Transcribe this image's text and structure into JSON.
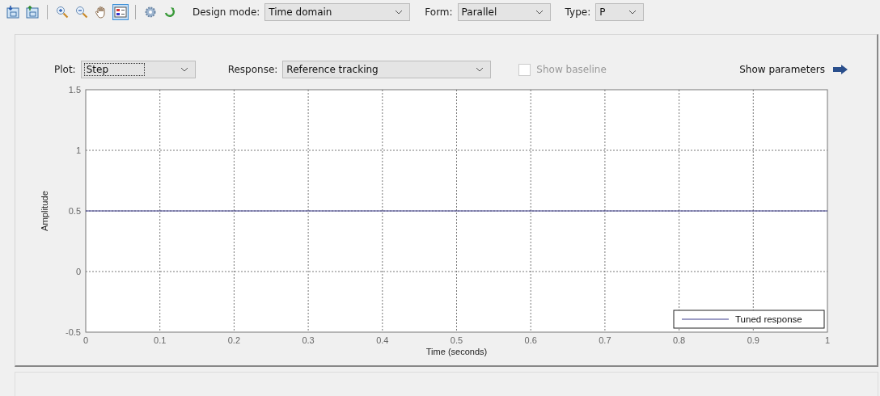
{
  "toolbar": {
    "tools": [
      {
        "kind": "import",
        "selected": false
      },
      {
        "kind": "export",
        "selected": false
      },
      {
        "kind": "separator"
      },
      {
        "kind": "zoom-in",
        "selected": false
      },
      {
        "kind": "zoom-out",
        "selected": false
      },
      {
        "kind": "pan",
        "selected": false
      },
      {
        "kind": "legend",
        "selected": true
      },
      {
        "kind": "separator"
      },
      {
        "kind": "settings",
        "selected": false
      },
      {
        "kind": "refresh",
        "selected": false
      }
    ],
    "fields": [
      {
        "label": "Design mode:",
        "value": "Time domain",
        "kind": "wide"
      },
      {
        "label": "Form:",
        "value": "Parallel",
        "kind": "medium"
      },
      {
        "label": "Type:",
        "value": "P",
        "kind": "narrow"
      }
    ]
  },
  "plot_controls": {
    "plot": {
      "label": "Plot:",
      "value": "Step"
    },
    "response": {
      "label": "Response:",
      "value": "Reference tracking"
    },
    "show_baseline": {
      "label": "Show baseline",
      "checked": false,
      "disabled": true
    },
    "show_parameters": "Show parameters"
  },
  "chart": {
    "chart_data": {
      "type": "line",
      "xlabel": "Time (seconds)",
      "ylabel": "Amplitude",
      "x": [
        0,
        1
      ],
      "series": [
        {
          "name": "Tuned response",
          "color": "#3c3c8c",
          "values": [
            0.5,
            0.5
          ]
        }
      ],
      "xlim": [
        0,
        1
      ],
      "ylim": [
        -0.5,
        1.5
      ],
      "xticks": [
        0,
        0.1,
        0.2,
        0.3,
        0.4,
        0.5,
        0.6,
        0.7,
        0.8,
        0.9,
        1
      ],
      "yticks": [
        -0.5,
        0,
        0.5,
        1,
        1.5
      ],
      "grid": true
    }
  }
}
